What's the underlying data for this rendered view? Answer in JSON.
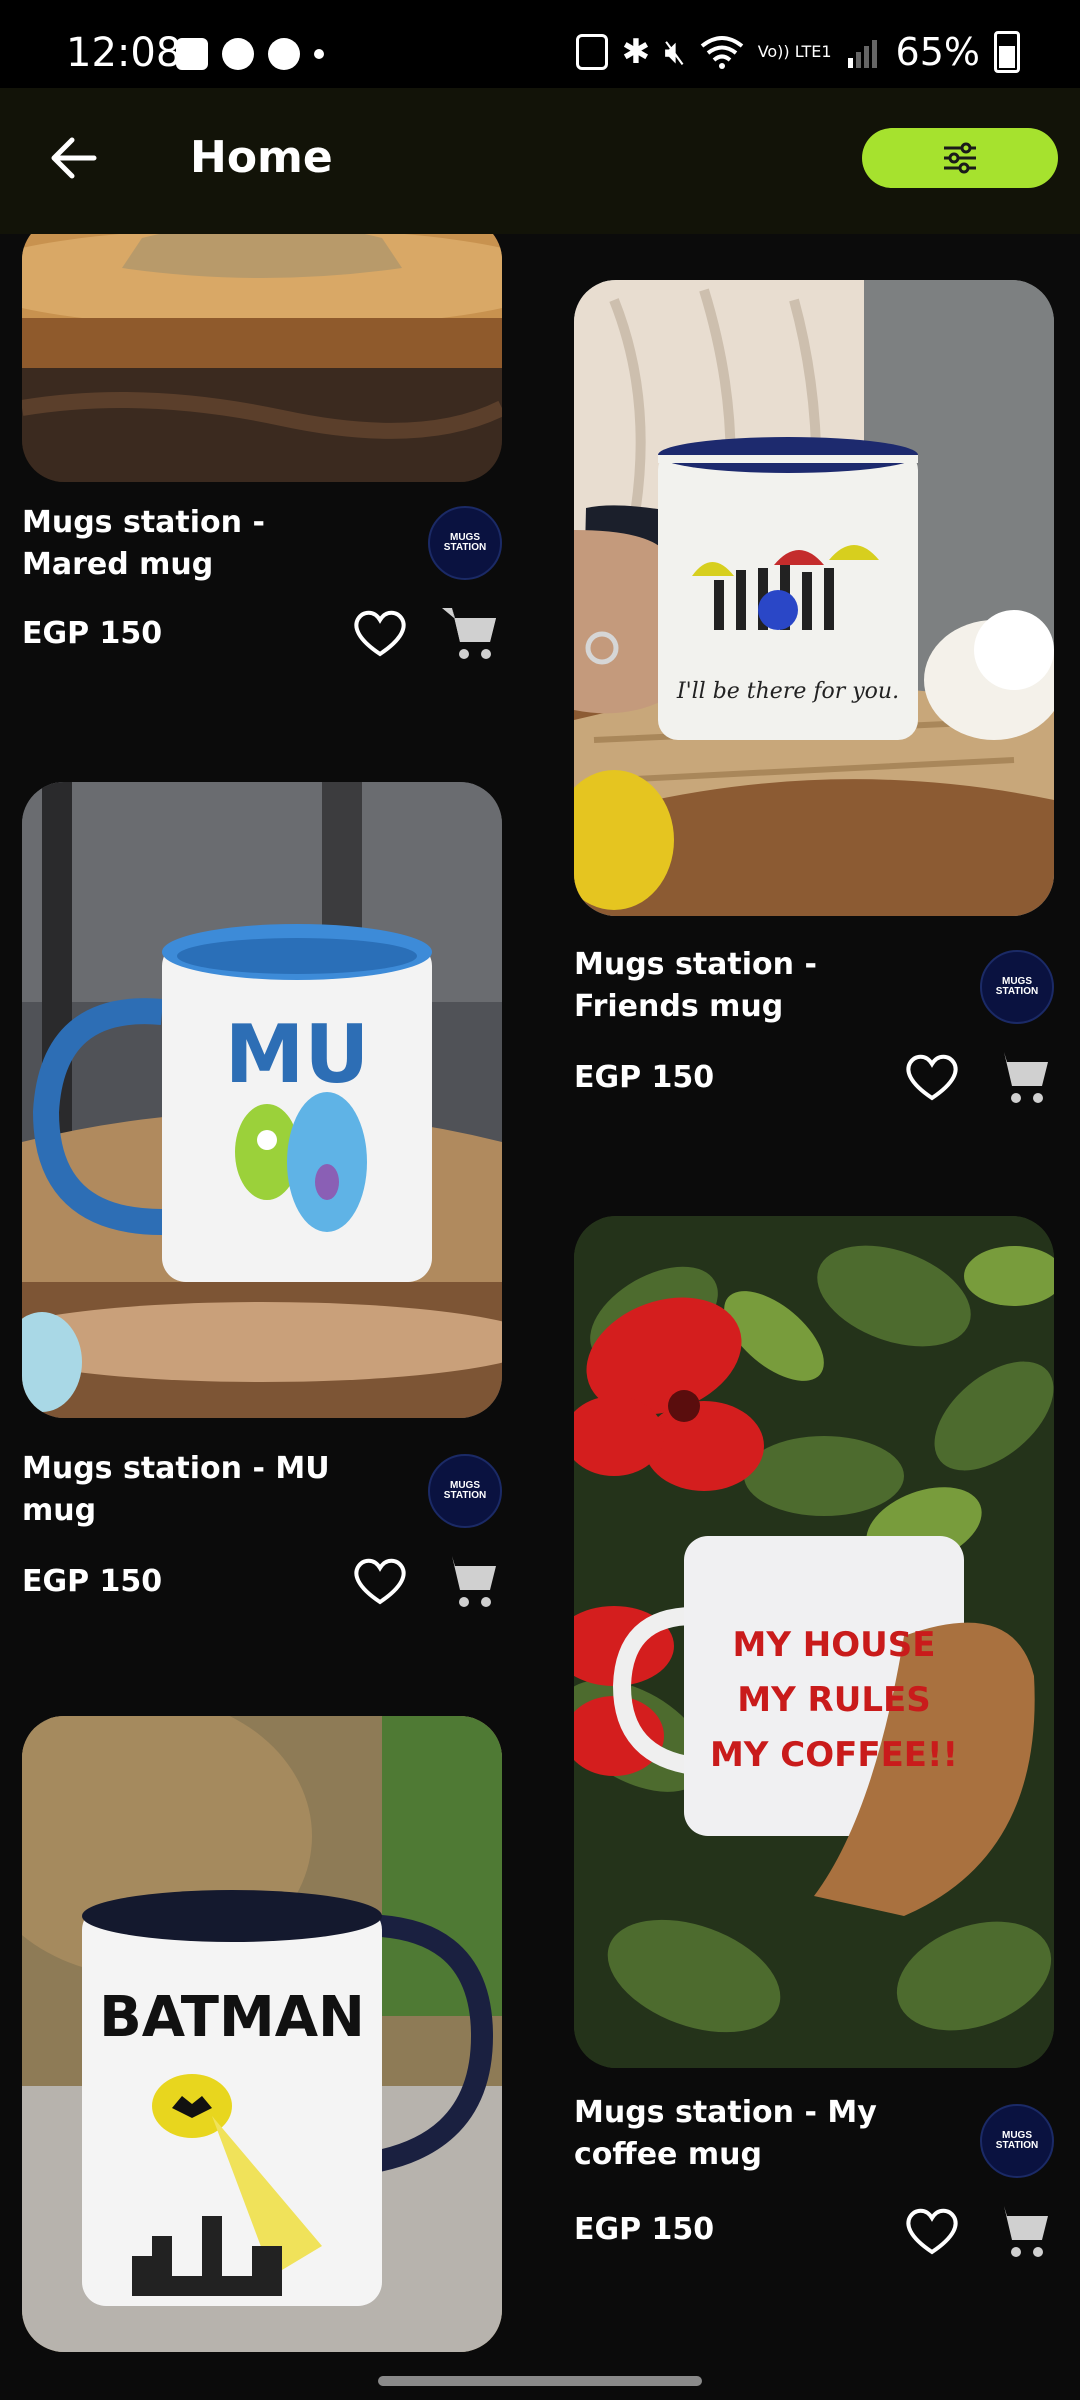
{
  "status_bar": {
    "time": "12:08",
    "battery": "65%",
    "network": "Vo)) LTE1"
  },
  "app_bar": {
    "title": "Home",
    "back_icon": "arrow-left-icon",
    "filter_icon": "sliders-icon",
    "filter_color": "#a6e22e"
  },
  "products": [
    {
      "name": "Mugs station  - Mared mug",
      "price": "EGP 150",
      "logo_text": "MUGS STATION"
    },
    {
      "name": "Mugs station  - Friends mug",
      "price": "EGP 150",
      "logo_text": "MUGS STATION"
    },
    {
      "name": "Mugs station  - MU mug",
      "price": "EGP 150",
      "logo_text": "MUGS STATION"
    },
    {
      "name": "Mugs station  - My coffee mug",
      "price": "EGP 150",
      "logo_text": "MUGS STATION"
    },
    {
      "name": "",
      "price": "",
      "logo_text": ""
    }
  ],
  "mug_prints": {
    "mu": "MU",
    "batman": "BATMAN",
    "coffee_1": "MY HOUSE",
    "coffee_2": "MY RULES",
    "coffee_3": "MY COFFEE!!",
    "friends": "I'll be there for you."
  }
}
